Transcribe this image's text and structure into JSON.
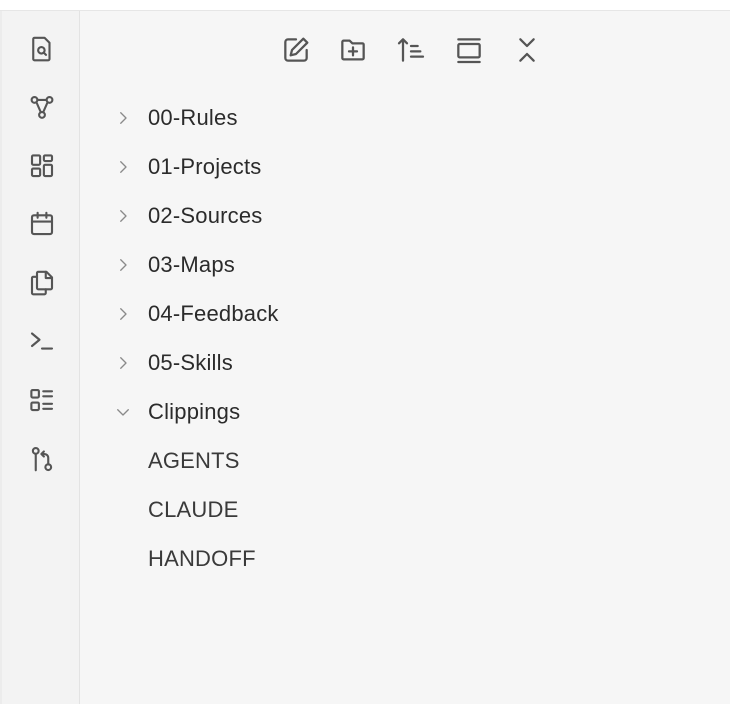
{
  "ribbon": {
    "icons": [
      "search-note-icon",
      "graph-icon",
      "dashboard-icon",
      "calendar-icon",
      "copy-icon",
      "terminal-icon",
      "checklist-icon",
      "git-branch-icon"
    ]
  },
  "toolbar": {
    "icons": [
      "new-note-icon",
      "new-folder-icon",
      "sort-icon",
      "collapse-view-icon",
      "collapse-all-icon"
    ]
  },
  "tree": {
    "folders": [
      {
        "label": "00-Rules",
        "expanded": false
      },
      {
        "label": "01-Projects",
        "expanded": false
      },
      {
        "label": "02-Sources",
        "expanded": false
      },
      {
        "label": "03-Maps",
        "expanded": false
      },
      {
        "label": "04-Feedback",
        "expanded": false
      },
      {
        "label": "05-Skills",
        "expanded": false
      },
      {
        "label": "Clippings",
        "expanded": true
      }
    ],
    "files": [
      {
        "label": "AGENTS"
      },
      {
        "label": "CLAUDE"
      },
      {
        "label": "HANDOFF"
      }
    ]
  }
}
